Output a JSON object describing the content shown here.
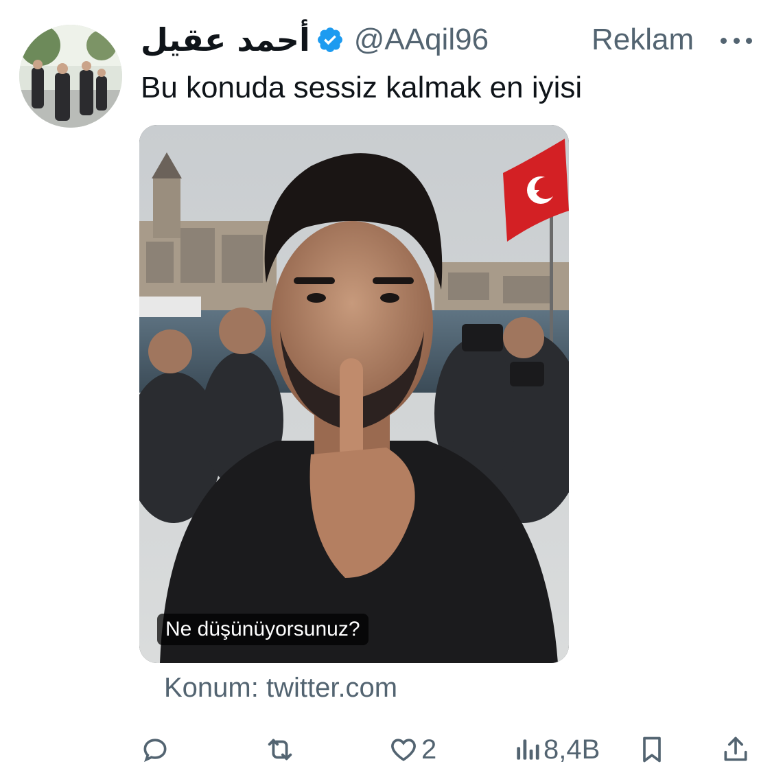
{
  "author": {
    "display_name": "أحمد عقيل",
    "handle": "@AAqil96",
    "verified": true,
    "verified_color": "#1d9bf0"
  },
  "ad_label": "Reklam",
  "tweet": {
    "text": "Bu konuda sessiz kalmak en iyisi"
  },
  "media": {
    "caption": "Ne düşünüyorsunuz?"
  },
  "source_line": "Konum: twitter.com",
  "actions": {
    "reply": {
      "icon": "reply-icon",
      "count": ""
    },
    "retweet": {
      "icon": "retweet-icon",
      "count": ""
    },
    "like": {
      "icon": "heart-icon",
      "count": "2"
    },
    "views": {
      "icon": "views-icon",
      "count": "8,4B"
    },
    "bookmark": {
      "icon": "bookmark-icon"
    },
    "share": {
      "icon": "share-icon"
    }
  },
  "colors": {
    "text": "#0f1419",
    "secondary": "#536471",
    "flag_red": "#d32024"
  }
}
